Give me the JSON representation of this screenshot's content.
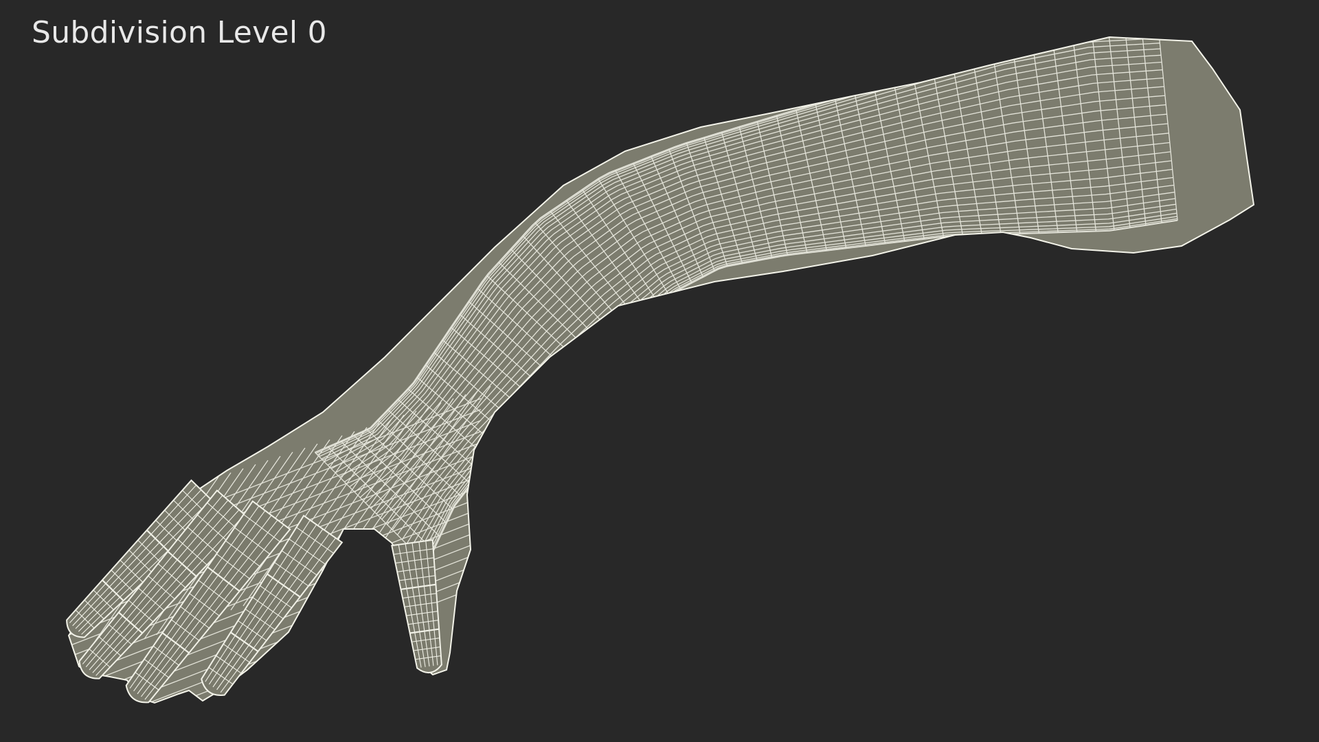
{
  "caption": "Subdivision Level 0",
  "colors": {
    "background": "#282828",
    "mesh_fill": "#7b7b6d",
    "mesh_fill_shadow": "#6a6a5e",
    "wire": "#f2f2e8"
  },
  "model": {
    "name": "wireframe arm mesh",
    "render_mode": "wireframe-on-shaded"
  }
}
